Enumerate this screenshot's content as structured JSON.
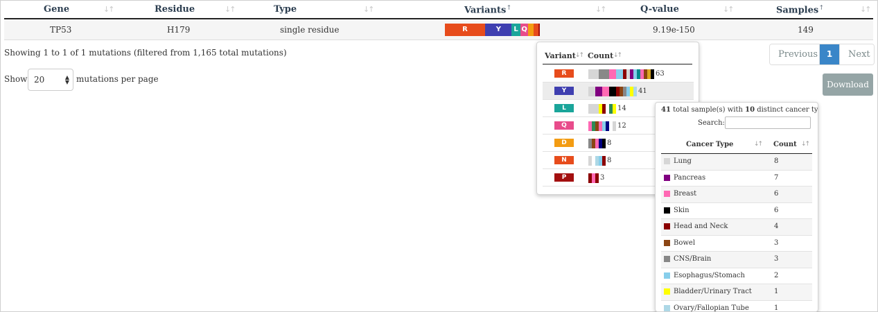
{
  "table": {
    "headers": {
      "gene": "Gene",
      "residue": "Residue",
      "type": "Type",
      "variants": "Variants",
      "variants_marker": "†",
      "qvalue": "Q-value",
      "samples": "Samples",
      "samples_marker": "†"
    },
    "sort_glyph": "↓↑",
    "row": {
      "gene": "TP53",
      "residue": "H179",
      "type": "single residue",
      "qvalue": "9.19e-150",
      "samples": "149",
      "variant_segments": [
        {
          "label": "R",
          "fraction": 0.423,
          "color": "#e74c1c"
        },
        {
          "label": "",
          "fraction": 0.004,
          "color": "#ffffff"
        },
        {
          "label": "Y",
          "fraction": 0.275,
          "color": "#3f3fb0"
        },
        {
          "label": "L",
          "fraction": 0.094,
          "color": "#1aa59a"
        },
        {
          "label": "Q",
          "fraction": 0.081,
          "color": "#e84c8b"
        },
        {
          "label": "",
          "fraction": 0.054,
          "color": "#f39c12"
        },
        {
          "label": "",
          "fraction": 0.054,
          "color": "#e74c1c"
        },
        {
          "label": "",
          "fraction": 0.015,
          "color": "#a30f0f"
        }
      ]
    }
  },
  "info": {
    "showing": "Showing 1 to 1 of 1 mutations (filtered from 1,165 total mutations)",
    "show_label": "Show",
    "per_page_value": "20",
    "per_page_suffix": "mutations per page"
  },
  "pagination": {
    "previous": "Previous",
    "current": "1",
    "next": "Next"
  },
  "download": "Download",
  "variant_popover": {
    "header_variant": "Variant",
    "header_count": "Count",
    "sort_glyph": "↓↑",
    "rows": [
      {
        "variant": "R",
        "count": "63",
        "color": "#e74c1c",
        "selected": false,
        "bar": [
          "#d6d6d6",
          "#d6d6d6",
          "#d6d6d6",
          "#888888",
          "#888888",
          "#888888",
          "#ff69b4",
          "#ff69b4",
          "#87ceeb",
          "#87ceeb",
          "#8b0000",
          "#d6d6d6",
          "#800080",
          "#87ceeb",
          "#008b8b",
          "#ff69b4",
          "#8b4513",
          "#daa520",
          "#000000"
        ]
      },
      {
        "variant": "Y",
        "count": "41",
        "color": "#3f3fb0",
        "selected": true,
        "bar": [
          "#d6d6d6",
          "#d6d6d6",
          "#800080",
          "#800080",
          "#ff69b4",
          "#ff69b4",
          "#000000",
          "#000000",
          "#8b0000",
          "#8b4513",
          "#888888",
          "#87ceeb",
          "#ffff00",
          "#add8e6"
        ]
      },
      {
        "variant": "L",
        "count": "14",
        "color": "#1aa59a",
        "selected": false,
        "bar": [
          "#d6d6d6",
          "#d6d6d6",
          "#d6d6d6",
          "#ffff00",
          "#8b0000",
          "#ffffff",
          "#2e8b57",
          "#ffff00"
        ]
      },
      {
        "variant": "Q",
        "count": "12",
        "color": "#e84c8b",
        "selected": false,
        "bar": [
          "#ff69b4",
          "#2e8b57",
          "#8b4513",
          "#ff69b4",
          "#87ceeb",
          "#000080",
          "#ffffff",
          "#d6d6d6"
        ]
      },
      {
        "variant": "D",
        "count": "8",
        "color": "#f39c12",
        "selected": false,
        "bar": [
          "#888888",
          "#8b4513",
          "#ff69b4",
          "#000080",
          "#000000"
        ]
      },
      {
        "variant": "N",
        "count": "8",
        "color": "#e74c1c",
        "selected": false,
        "bar": [
          "#d6d6d6",
          "#ffffff",
          "#add8e6",
          "#87ceeb",
          "#8b0000"
        ]
      },
      {
        "variant": "P",
        "count": "3",
        "color": "#a30f0f",
        "selected": false,
        "bar": [
          "#8b0000",
          "#ff69b4",
          "#8b0000"
        ]
      }
    ]
  },
  "cancer_popover": {
    "summary_total": "41",
    "summary_mid": " total sample(s) with ",
    "summary_types": "10",
    "summary_end": " distinct cancer type(s)",
    "search_label": "Search:",
    "header_type": "Cancer Type",
    "header_count": "Count",
    "sort_glyph": "↓↑",
    "rows": [
      {
        "name": "Lung",
        "count": "8",
        "color": "#d6d6d6"
      },
      {
        "name": "Pancreas",
        "count": "7",
        "color": "#800080"
      },
      {
        "name": "Breast",
        "count": "6",
        "color": "#ff69b4"
      },
      {
        "name": "Skin",
        "count": "6",
        "color": "#000000"
      },
      {
        "name": "Head and Neck",
        "count": "4",
        "color": "#8b0000"
      },
      {
        "name": "Bowel",
        "count": "3",
        "color": "#8b4513"
      },
      {
        "name": "CNS/Brain",
        "count": "3",
        "color": "#888888"
      },
      {
        "name": "Esophagus/Stomach",
        "count": "2",
        "color": "#87ceeb"
      },
      {
        "name": "Bladder/Urinary Tract",
        "count": "1",
        "color": "#ffff00"
      },
      {
        "name": "Ovary/Fallopian Tube",
        "count": "1",
        "color": "#add8e6"
      }
    ]
  }
}
